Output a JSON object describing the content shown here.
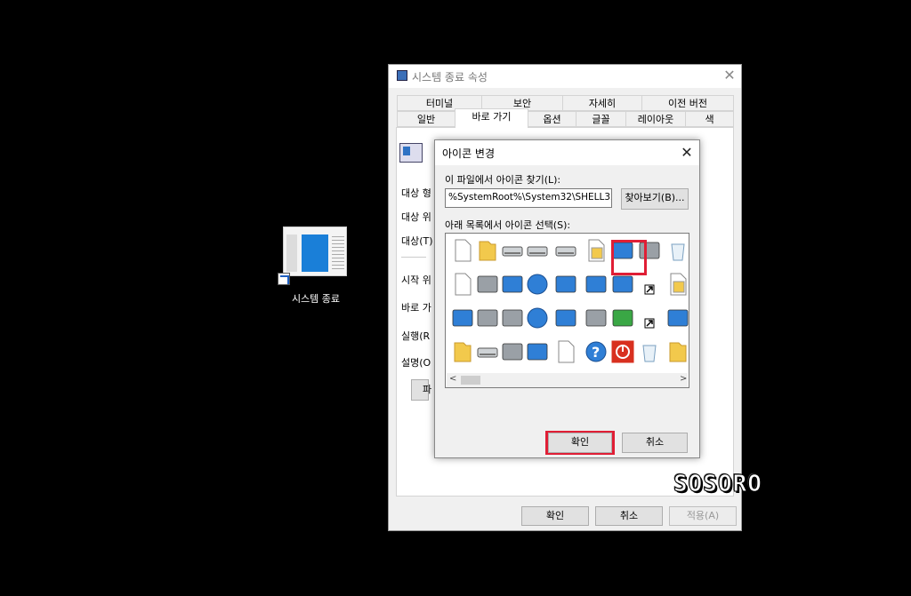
{
  "desktop": {
    "shortcut_label": "시스템 종료"
  },
  "properties_window": {
    "title": "시스템 종료 속성",
    "tabs_row1": [
      "터미널",
      "보안",
      "자세히",
      "이전 버전"
    ],
    "tabs_row2": [
      "일반",
      "바로 가기",
      "옵션",
      "글꼴",
      "레이아웃",
      "색"
    ],
    "active_tab": "바로 가기",
    "side_labels": [
      "대상 형",
      "대상 위",
      "대상(T)",
      "시작 위",
      "바로 가",
      "실행(R",
      "설명(O"
    ],
    "open_file_button": "파",
    "ok": "확인",
    "cancel": "취소",
    "apply": "적용(A)"
  },
  "change_icon_dialog": {
    "title": "아이콘 변경",
    "find_label": "이 파일에서 아이콘 찾기(L):",
    "path_value": "%SystemRoot%\\System32\\SHELL32.dl",
    "browse": "찾아보기(B)...",
    "list_label": "아래 목록에서 아이콘 선택(S):",
    "ok": "확인",
    "cancel": "취소",
    "icons": [
      [
        "document-icon",
        "folder-icon",
        "drive-icon",
        "chip-icon",
        "printer-icon",
        "file-clock-icon",
        "window-icon",
        "hand-share-icon",
        "recycle-icon"
      ],
      [
        "text-doc-icon",
        "computer-icon",
        "network-drive-icon",
        "globe-icon",
        "network-computer-icon",
        "control-panel-icon",
        "settings-window-icon",
        "shortcut-arrow-icon",
        "lock-doc-icon"
      ],
      [
        "app-window-icon",
        "floppy-icon",
        "drive-delete-icon",
        "globe-mouse-icon",
        "network-icon",
        "search-icon",
        "green-arrow-icon",
        "clock-small-icon",
        "blue-square-icon"
      ],
      [
        "folder-open-icon",
        "disk-drive-icon",
        "cd-drive-icon",
        "monitor-icon",
        "grid-doc-icon",
        "help-icon",
        "power-icon",
        "recycle-bin-icon",
        "zip-folder-icon"
      ]
    ],
    "selected_icon": "power-icon"
  },
  "watermark": "SOSORO",
  "colors": {
    "highlight_red": "#e01e35",
    "power_red": "#d8301f",
    "accent_blue": "#1a7fd8"
  }
}
